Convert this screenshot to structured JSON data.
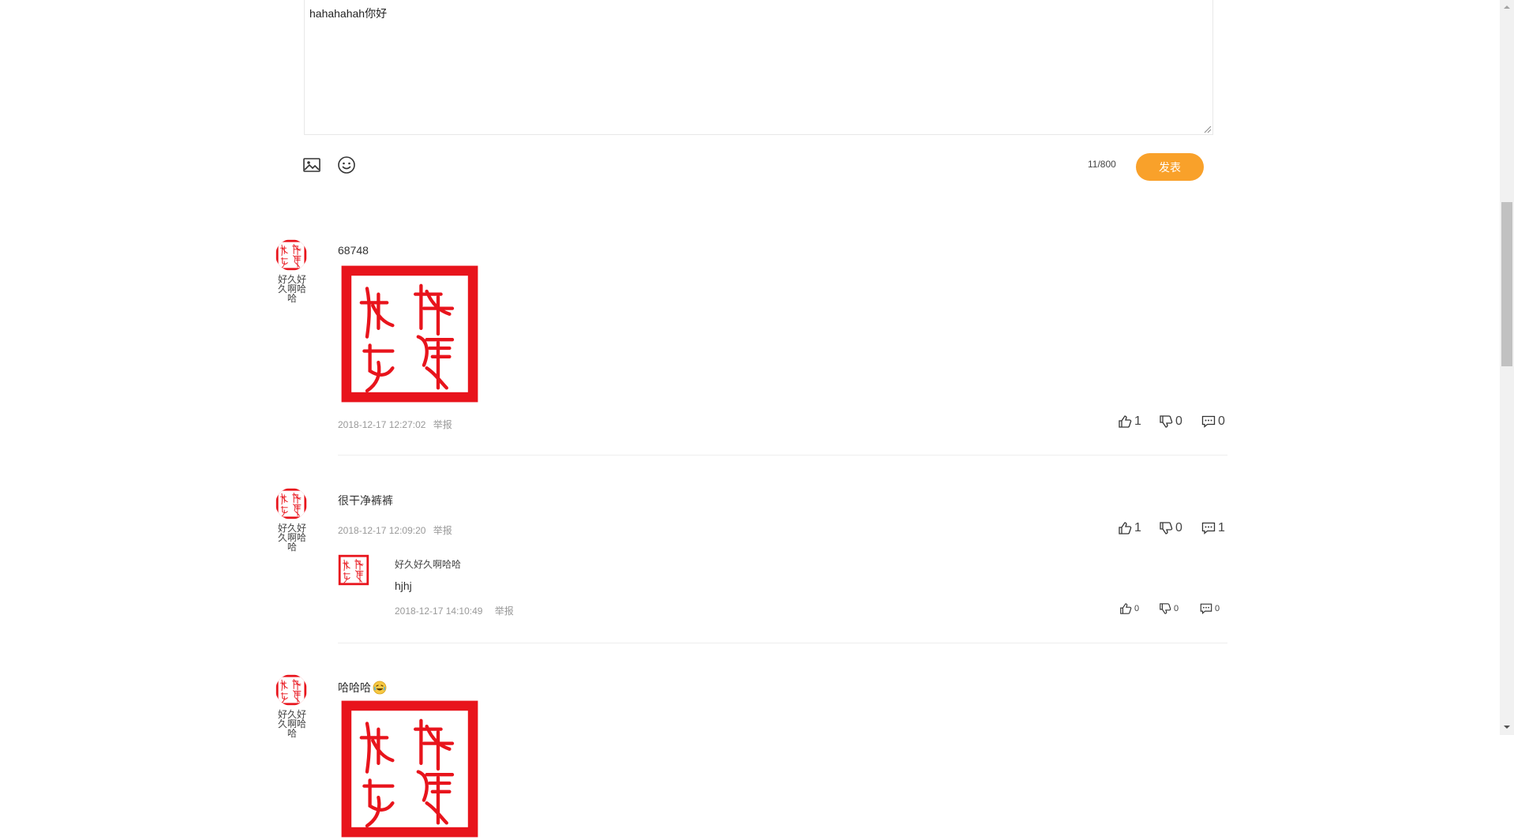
{
  "composer": {
    "text": "hahahahah你好",
    "counter": "11/800",
    "publish_label": "发表",
    "image_icon": "image-icon",
    "emoji_icon": "smiley-icon"
  },
  "comments": [
    {
      "username": "好久好久啊哈哈",
      "text": "68748",
      "has_image": true,
      "timestamp": "2018-12-17 12:27:02",
      "report_label": "举报",
      "likes": "1",
      "dislikes": "0",
      "replies_count": "0"
    },
    {
      "username": "好久好久啊哈哈",
      "text": "很干净裤裤",
      "has_image": false,
      "timestamp": "2018-12-17 12:09:20",
      "report_label": "举报",
      "likes": "1",
      "dislikes": "0",
      "replies_count": "1",
      "replies": [
        {
          "username": "好久好久啊哈哈",
          "text": "hjhj",
          "timestamp": "2018-12-17 14:10:49",
          "report_label": "举报",
          "likes": "0",
          "dislikes": "0",
          "replies_count": "0"
        }
      ]
    },
    {
      "username": "好久好久啊哈哈",
      "text": "哈哈哈",
      "emoji": "laughing-emoji",
      "has_image": true
    }
  ],
  "colors": {
    "accent": "#f9a12a",
    "stamp_red": "#e8141c"
  },
  "stamp_image": "red-seal-stamp"
}
